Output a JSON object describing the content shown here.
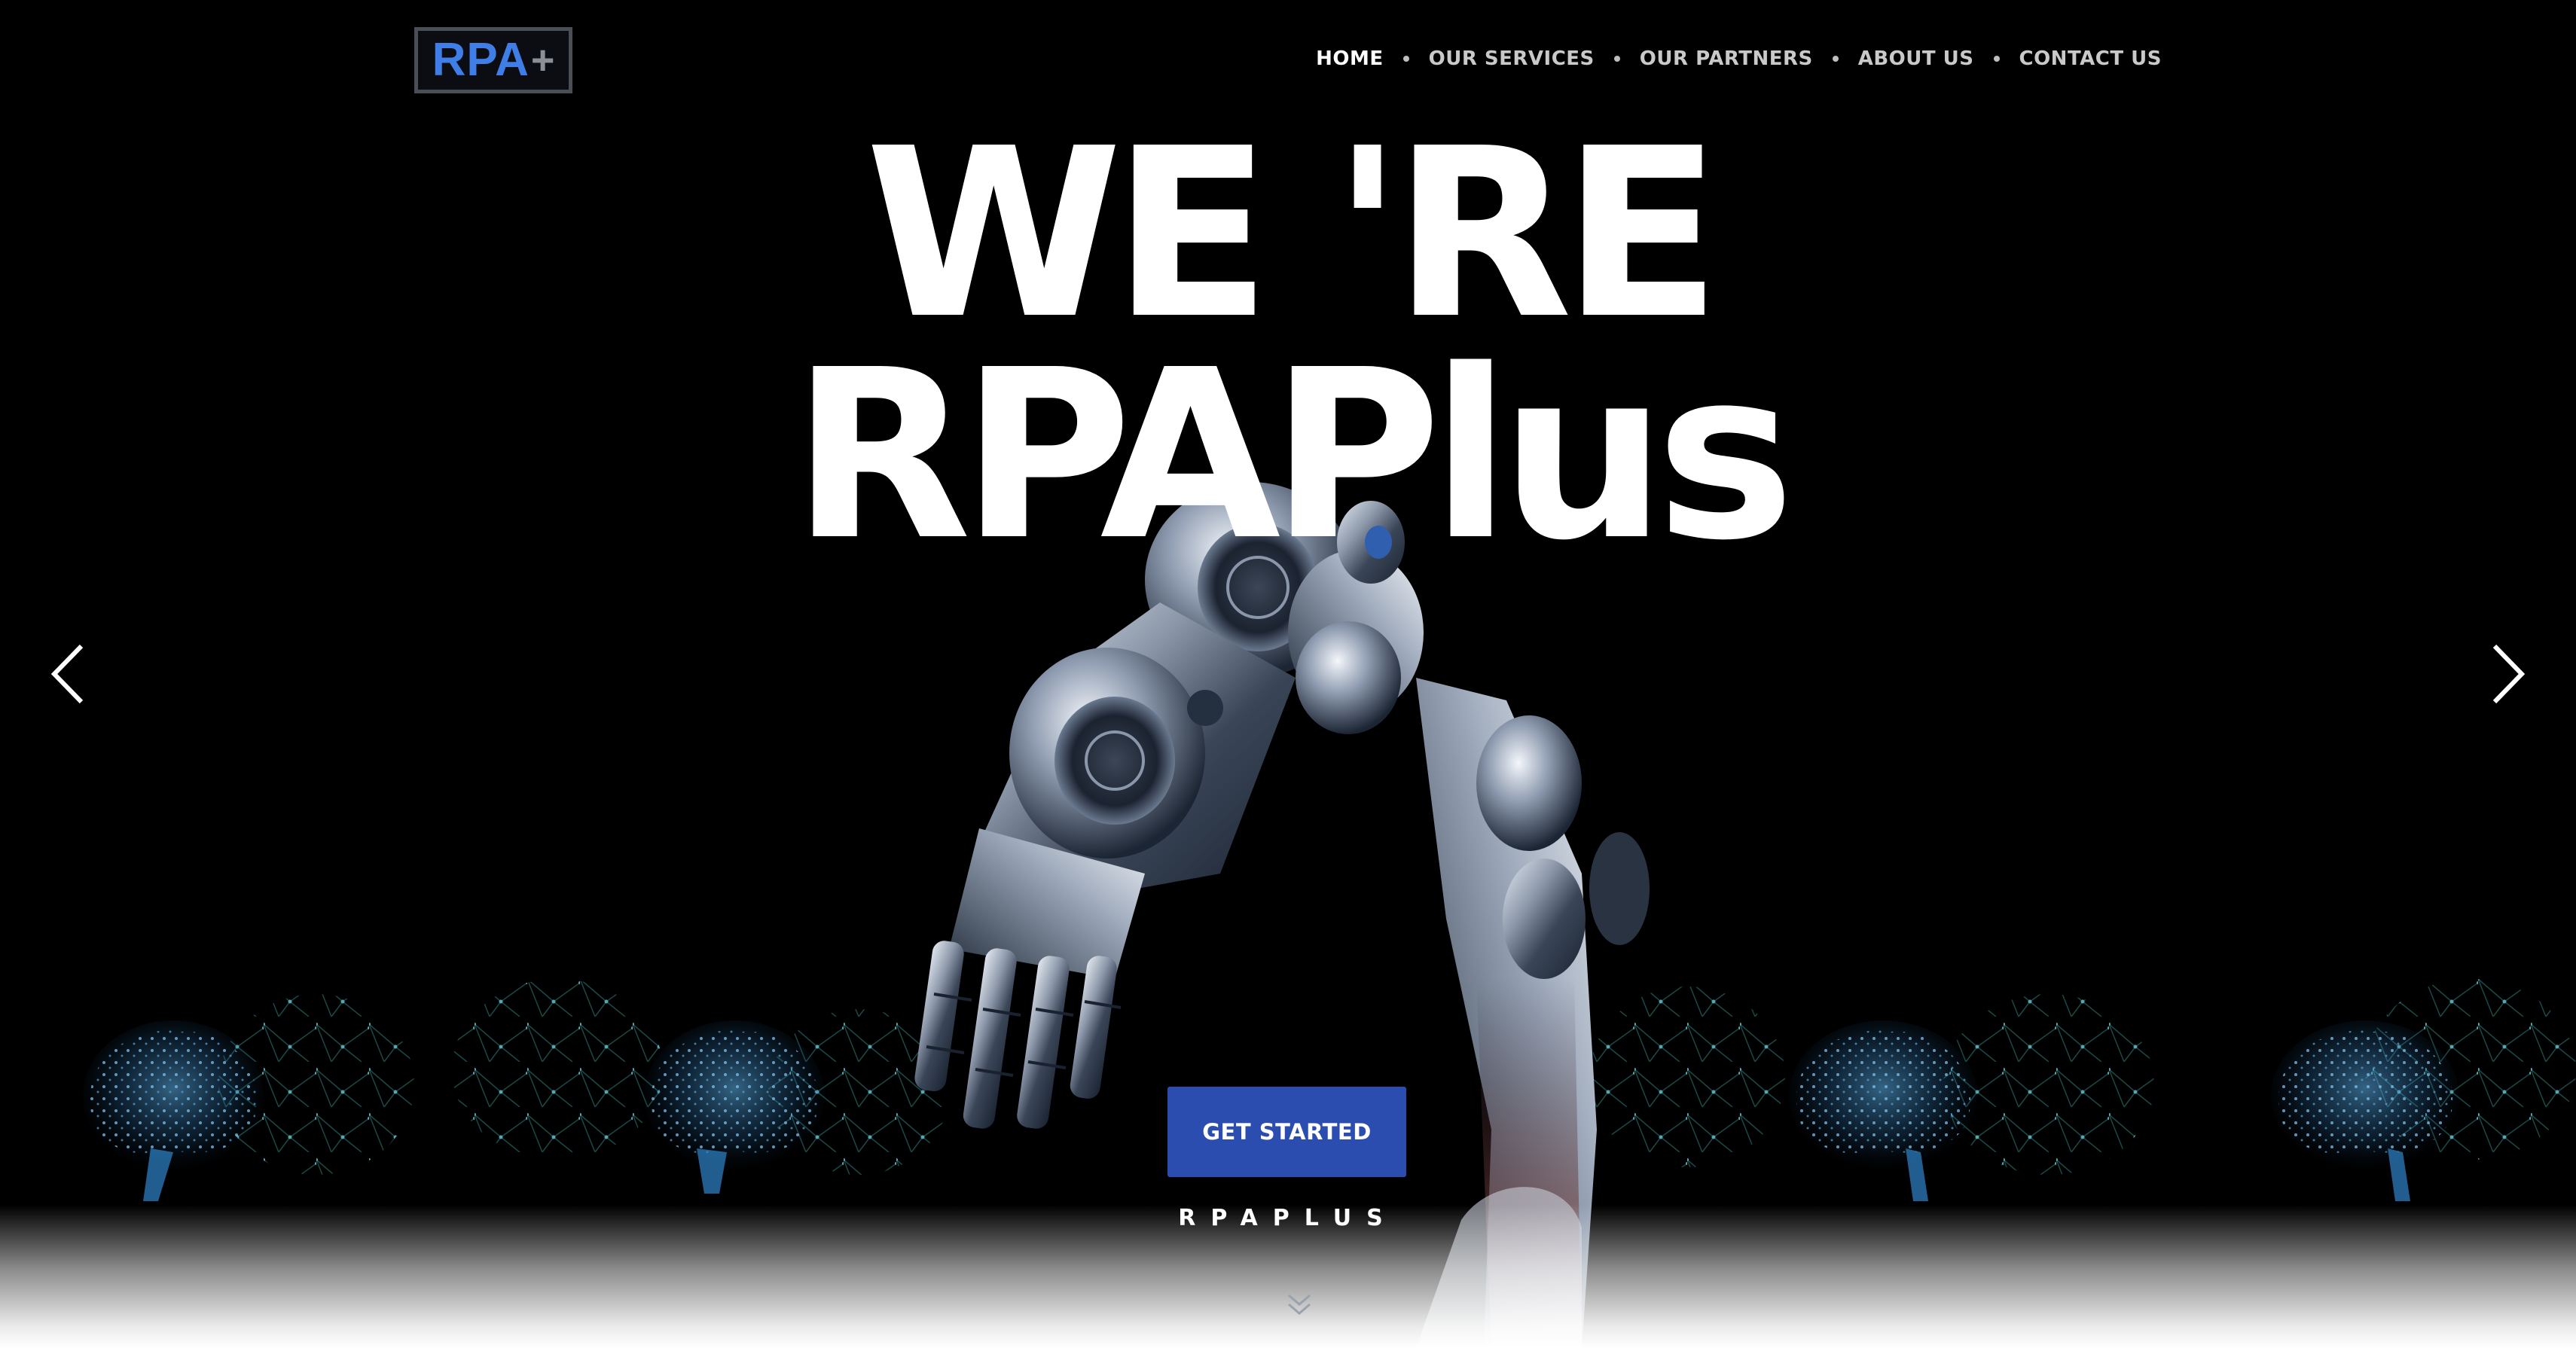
{
  "logo": {
    "text": "RPA",
    "symbol": "+",
    "text_color": "#3f7ee6",
    "symbol_color": "#8b8f96"
  },
  "nav": {
    "items": [
      {
        "label": "HOME",
        "active": true
      },
      {
        "label": "OUR SERVICES",
        "active": false
      },
      {
        "label": "OUR PARTNERS",
        "active": false
      },
      {
        "label": "ABOUT US",
        "active": false
      },
      {
        "label": "CONTACT US",
        "active": false
      }
    ]
  },
  "hero": {
    "headline_line1": "WE 'RE",
    "headline_line2": "RPAPlus",
    "cta_label": "GET STARTED",
    "tagline": "RPAPLUS",
    "prev_icon": "chevron-left-icon",
    "next_icon": "chevron-right-icon",
    "scroll_icon": "double-chevron-down-icon"
  },
  "colors": {
    "background": "#000000",
    "accent": "#2b4db0",
    "network": "#4fa8e8"
  }
}
